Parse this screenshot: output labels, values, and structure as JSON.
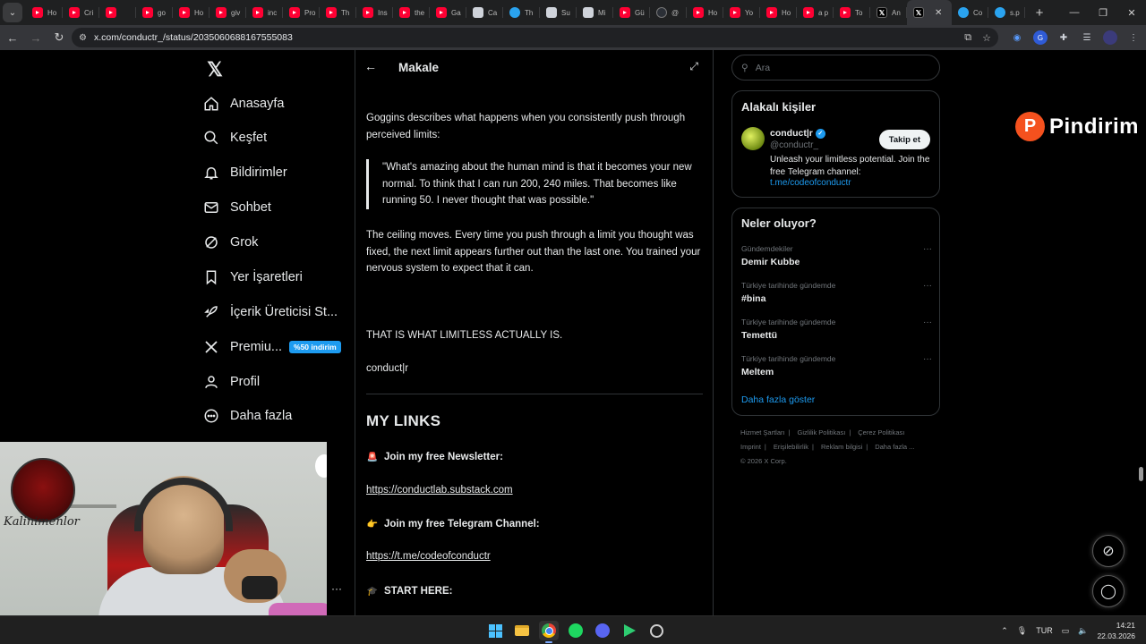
{
  "browser": {
    "tabs": [
      {
        "label": "Ho",
        "icon": "yt"
      },
      {
        "label": "Cri",
        "icon": "yt"
      },
      {
        "label": "",
        "icon": "yt"
      },
      {
        "label": "go",
        "icon": "yt"
      },
      {
        "label": "Ho",
        "icon": "yt"
      },
      {
        "label": "giv",
        "icon": "yt"
      },
      {
        "label": "inc",
        "icon": "yt"
      },
      {
        "label": "Pro",
        "icon": "yt"
      },
      {
        "label": "Th",
        "icon": "yt"
      },
      {
        "label": "Ins",
        "icon": "yt"
      },
      {
        "label": "the",
        "icon": "yt"
      },
      {
        "label": "Ga",
        "icon": "yt"
      },
      {
        "label": "Ca",
        "icon": "st"
      },
      {
        "label": "Th",
        "icon": "tg"
      },
      {
        "label": "Su",
        "icon": "st"
      },
      {
        "label": "Mi",
        "icon": "st"
      },
      {
        "label": "Gü",
        "icon": "yt"
      },
      {
        "label": "@",
        "icon": "gb"
      },
      {
        "label": "Ho",
        "icon": "yt"
      },
      {
        "label": "Yo",
        "icon": "yt"
      },
      {
        "label": "Ho",
        "icon": "yt"
      },
      {
        "label": "a p",
        "icon": "yt"
      },
      {
        "label": "To",
        "icon": "yt"
      },
      {
        "label": "An",
        "icon": "x"
      },
      {
        "label": "",
        "icon": "x",
        "active": true
      },
      {
        "label": "Co",
        "icon": "tg"
      },
      {
        "label": "s.p",
        "icon": "tg"
      }
    ],
    "url": "x.com/conductr_/status/2035060688167555083"
  },
  "left_nav": {
    "items": [
      {
        "label": "Anasayfa",
        "icon": "home-icon"
      },
      {
        "label": "Keşfet",
        "icon": "search-icon"
      },
      {
        "label": "Bildirimler",
        "icon": "bell-icon"
      },
      {
        "label": "Sohbet",
        "icon": "mail-icon"
      },
      {
        "label": "Grok",
        "icon": "grok-icon"
      },
      {
        "label": "Yer İşaretleri",
        "icon": "bookmark-icon"
      },
      {
        "label": "İçerik Üreticisi St...",
        "icon": "rocket-icon"
      },
      {
        "label": "Premiu...",
        "icon": "x-icon"
      },
      {
        "label": "Profil",
        "icon": "person-icon"
      },
      {
        "label": "Daha fazla",
        "icon": "more-icon"
      }
    ],
    "premium_badge": "%50 indirim"
  },
  "article": {
    "header_title": "Makale",
    "para1": "Goggins describes what happens when you consistently push through perceived limits:",
    "quote": "\"What's amazing about the human mind is that it becomes your new normal. To think that I can run 200, 240 miles. That becomes like running 50. I never thought that was possible.\"",
    "para2": "The ceiling moves. Every time you push through a limit you thought was fixed, the next limit appears further out than the last one. You trained your nervous system to expect that it can.",
    "para3": "THAT IS WHAT LIMITLESS ACTUALLY IS.",
    "signature": "conduct|r",
    "links_heading": "MY LINKS",
    "newsletter_label": "Join my free Newsletter:",
    "newsletter_url": "https://conductlab.substack.com",
    "telegram_label": "Join my free Telegram Channel:",
    "telegram_url": "https://t.me/codeofconductr",
    "start_label": "START HERE:"
  },
  "right_rail": {
    "search_placeholder": "Ara",
    "related_title": "Alakalı kişiler",
    "person_name": "conduct|r",
    "person_handle": "@conductr_",
    "follow_label": "Takip et",
    "bio": "Unleash your limitless potential. Join the free Telegram channel:",
    "bio_link": "t.me/codeofconductr",
    "trends_title": "Neler oluyor?",
    "trends": [
      {
        "context": "Gündemdekiler",
        "name": "Demir Kubbe"
      },
      {
        "context": "Türkiye tarihinde gündemde",
        "name": "#bina"
      },
      {
        "context": "Türkiye tarihinde gündemde",
        "name": "Temettü"
      },
      {
        "context": "Türkiye tarihinde gündemde",
        "name": "Meltem"
      }
    ],
    "show_more": "Daha fazla göster",
    "footer_links": [
      "Hizmet Şartları",
      "Gizlilik Politikası",
      "Çerez Politikası",
      "Imprint",
      "Erişilebilirlik",
      "Reklam bilgisi",
      "Daha fazla ..."
    ],
    "copyright": "© 2026 X Corp."
  },
  "overlay": {
    "brand_text": "Pindirim",
    "webcam_text": "Kalinimenlor"
  },
  "taskbar": {
    "lang": "TUR",
    "time": "14:21",
    "date": "22.03.2026"
  }
}
